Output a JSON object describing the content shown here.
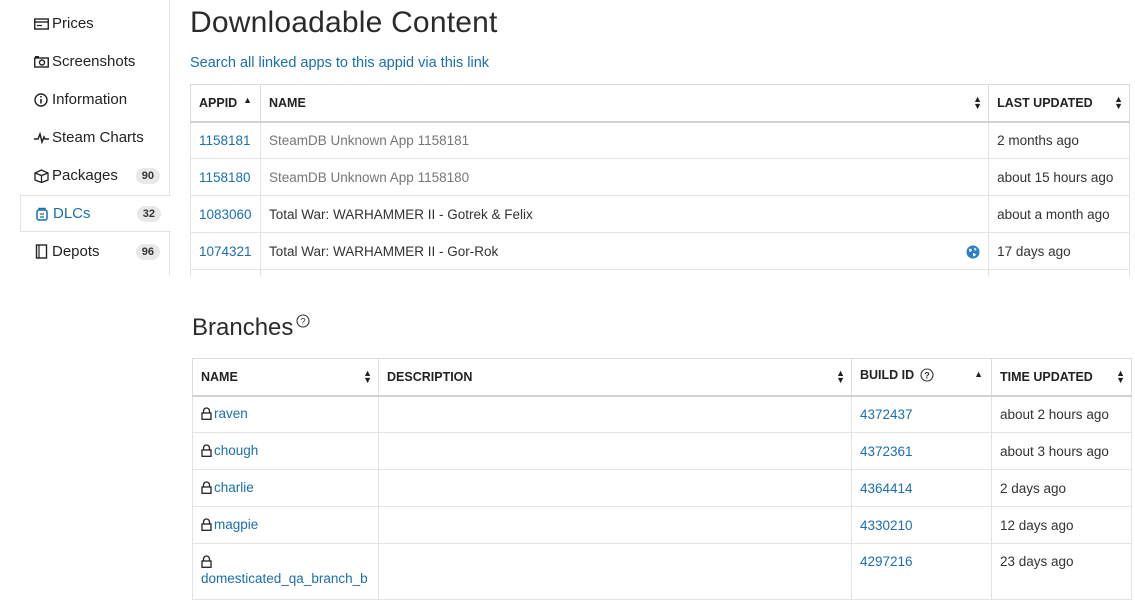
{
  "sidebar": {
    "items": [
      {
        "label": "Prices",
        "icon": "price-tag-icon",
        "badge": null
      },
      {
        "label": "Screenshots",
        "icon": "camera-icon",
        "badge": null
      },
      {
        "label": "Information",
        "icon": "info-icon",
        "badge": null
      },
      {
        "label": "Steam Charts",
        "icon": "chart-pulse-icon",
        "badge": null
      },
      {
        "label": "Packages",
        "icon": "package-icon",
        "badge": "90"
      },
      {
        "label": "DLCs",
        "icon": "dlc-icon",
        "badge": "32",
        "active": true
      },
      {
        "label": "Depots",
        "icon": "depot-icon",
        "badge": "96"
      }
    ]
  },
  "dlc": {
    "title": "Downloadable Content",
    "search_link": "Search all linked apps to this appid via this link",
    "columns": [
      "APPID",
      "NAME",
      "LAST UPDATED"
    ],
    "rows": [
      {
        "appid": "1158181",
        "name": "SteamDB Unknown App 1158181",
        "updated": "2 months ago",
        "unknown": true
      },
      {
        "appid": "1158180",
        "name": "SteamDB Unknown App 1158180",
        "updated": "about 15 hours ago",
        "unknown": true
      },
      {
        "appid": "1083060",
        "name": "Total War: WARHAMMER II - Gotrek & Felix",
        "updated": "about a month ago"
      },
      {
        "appid": "1074321",
        "name": "Total War: WARHAMMER II - Gor-Rok",
        "updated": "17 days ago",
        "globe": true
      }
    ]
  },
  "branches": {
    "title": "Branches",
    "columns": [
      "NAME",
      "DESCRIPTION",
      "BUILD ID",
      "TIME UPDATED"
    ],
    "rows": [
      {
        "name": "raven",
        "description": "",
        "build_id": "4372437",
        "updated": "about 2 hours ago"
      },
      {
        "name": "chough",
        "description": "",
        "build_id": "4372361",
        "updated": "about 3 hours ago"
      },
      {
        "name": "charlie",
        "description": "",
        "build_id": "4364414",
        "updated": "2 days ago"
      },
      {
        "name": "magpie",
        "description": "",
        "build_id": "4330210",
        "updated": "12 days ago"
      },
      {
        "name": "domesticated_qa_branch_b",
        "description": "",
        "build_id": "4297216",
        "updated": "23 days ago"
      }
    ]
  },
  "colors": {
    "link": "#1a6fb0",
    "border": "#e3e3e3",
    "badge_bg": "#e8e8e8"
  }
}
